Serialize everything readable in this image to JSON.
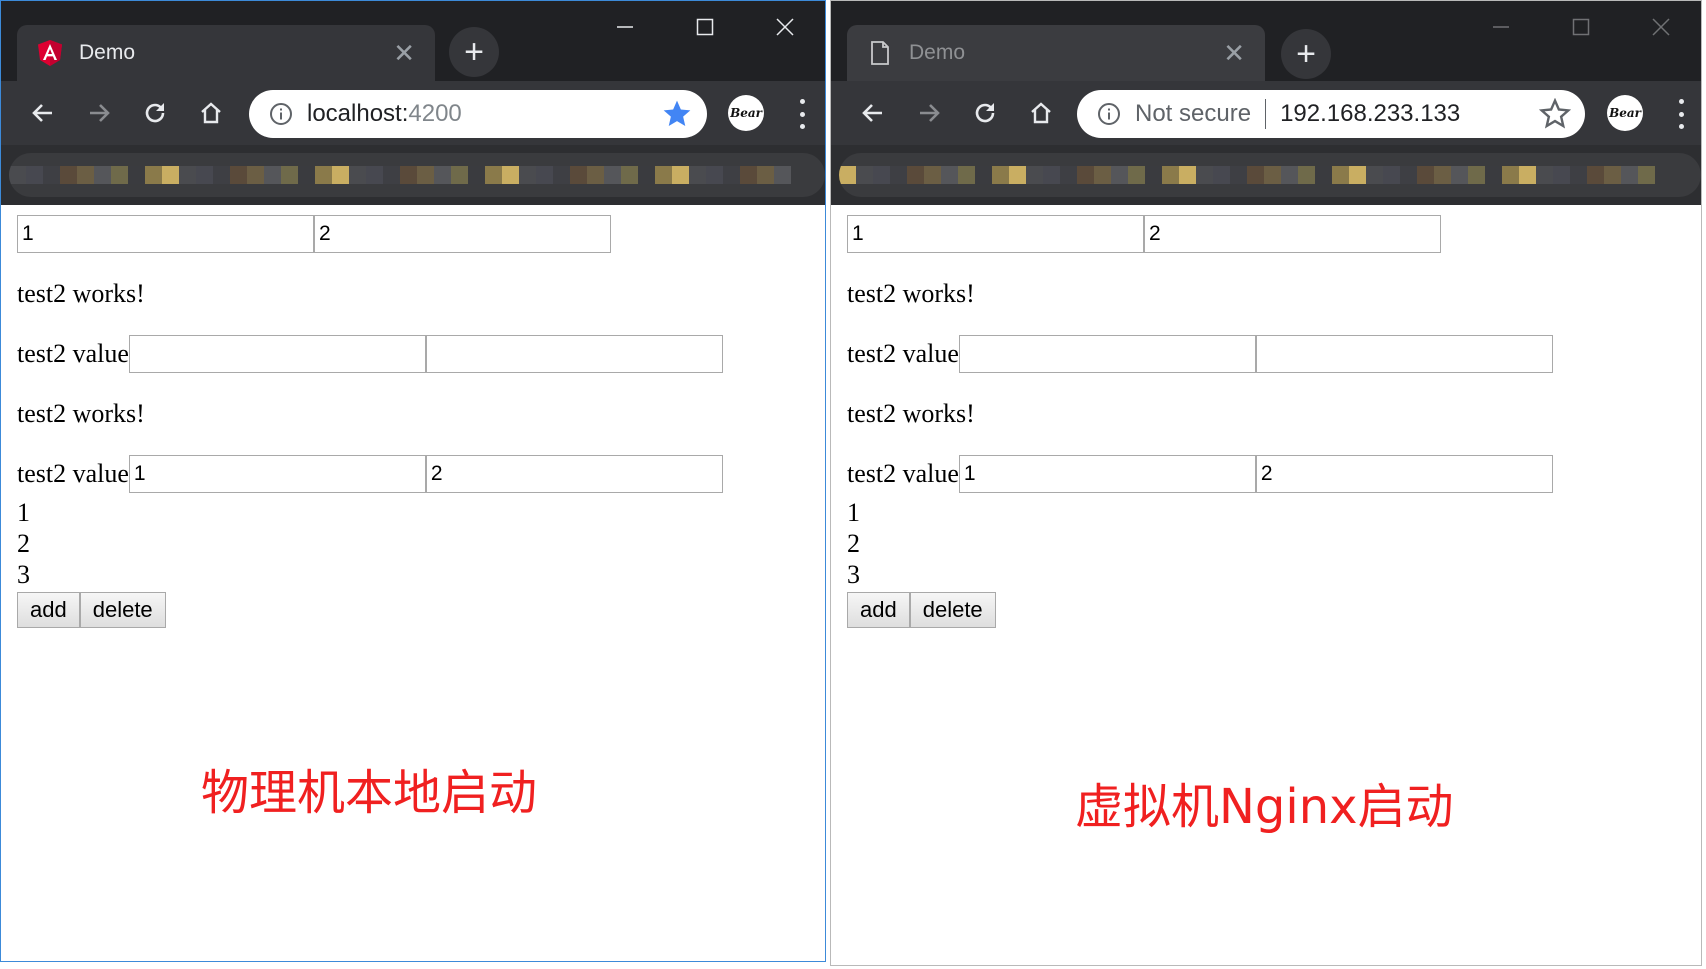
{
  "left": {
    "tab_title": "Demo",
    "tab_close": "✕",
    "new_tab": "+",
    "url_host": "localhost:",
    "url_port": "4200",
    "avatar_text": "Bear",
    "inputs_row1": [
      "1",
      "2"
    ],
    "works_1": "test2 works!",
    "value_label": "test2 value",
    "inputs_row2": [
      "",
      ""
    ],
    "works_2": "test2 works!",
    "inputs_row3": [
      "1",
      "2"
    ],
    "numbers": [
      "1",
      "2",
      "3"
    ],
    "add_label": "add",
    "delete_label": "delete",
    "caption": "物理机本地启动"
  },
  "right": {
    "tab_title": "Demo",
    "tab_close": "✕",
    "new_tab": "+",
    "not_secure": "Not secure",
    "url_host": "192.168.233.133",
    "avatar_text": "Bear",
    "inputs_row1": [
      "1",
      "2"
    ],
    "works_1": "test2 works!",
    "value_label": "test2 value",
    "inputs_row2": [
      "",
      ""
    ],
    "works_2": "test2 works!",
    "inputs_row3": [
      "1",
      "2"
    ],
    "numbers": [
      "1",
      "2",
      "3"
    ],
    "add_label": "add",
    "delete_label": "delete",
    "caption": "虚拟机Nginx启动"
  },
  "colors": {
    "caption": "#f02020",
    "accent_star": "#4285f4",
    "chrome_dark": "#202124",
    "angular_red": "#dd0031"
  },
  "icons": {
    "back": "arrow-left-icon",
    "forward": "arrow-right-icon",
    "reload": "reload-icon",
    "home": "home-icon",
    "info": "info-icon",
    "bookmark": "star-icon",
    "menu": "more-vert-icon",
    "minimize": "minimize-icon",
    "maximize": "maximize-icon",
    "close": "close-icon"
  }
}
